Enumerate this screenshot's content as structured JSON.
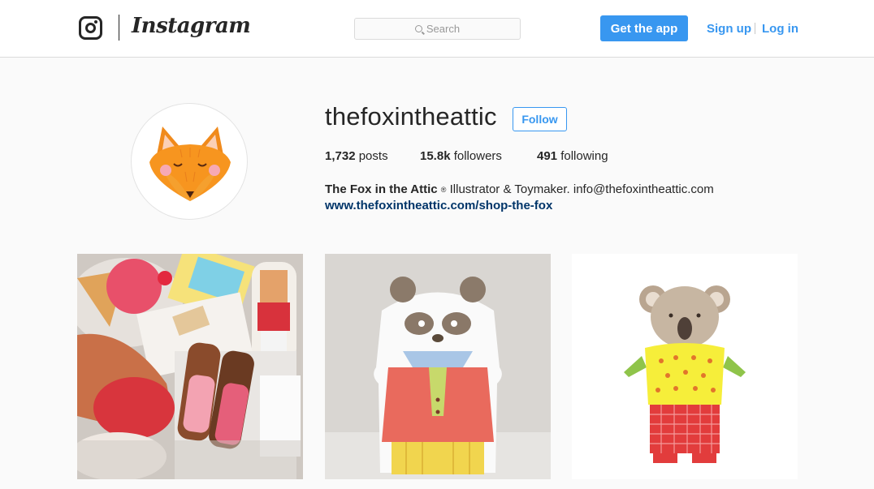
{
  "header": {
    "wordmark": "Instagram",
    "search_placeholder": "Search",
    "get_app_label": "Get the app",
    "signup_label": "Sign up",
    "login_label": "Log in"
  },
  "profile": {
    "username": "thefoxintheattic",
    "follow_label": "Follow",
    "stats": {
      "posts_count": "1,732",
      "posts_label": "posts",
      "followers_count": "15.8k",
      "followers_label": "followers",
      "following_count": "491",
      "following_label": "following"
    },
    "bio": {
      "name": "The Fox in the Attic",
      "reg_mark": "®",
      "text": "Illustrator & Toymaker. info@thefoxintheattic.com",
      "link": "www.thefoxintheattic.com/shop-the-fox"
    }
  },
  "grid": [
    {
      "name": "plush-toys-photo"
    },
    {
      "name": "panda-plush-photo"
    },
    {
      "name": "koala-illustration"
    }
  ],
  "colors": {
    "accent": "#3897f0",
    "link_dark": "#003569",
    "text": "#262626",
    "background": "#fafafa"
  }
}
